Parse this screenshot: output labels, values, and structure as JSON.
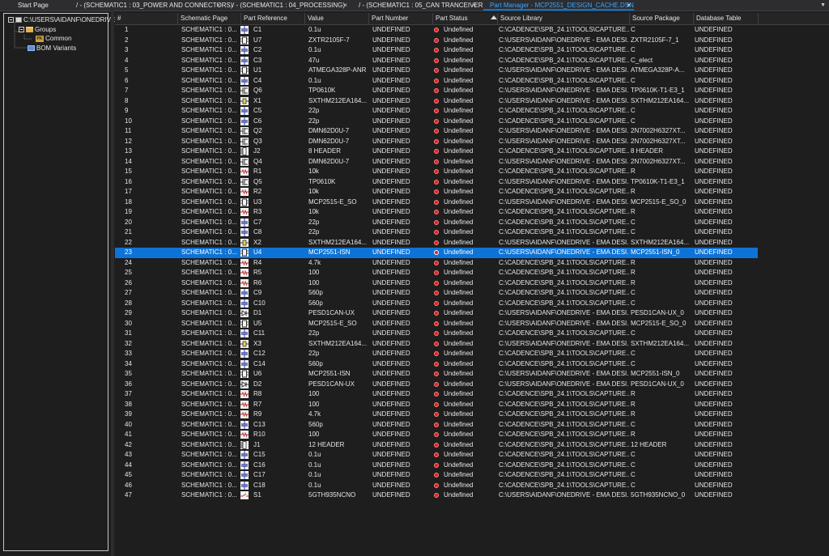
{
  "tabs": [
    {
      "label": "Start Page",
      "close": "×"
    },
    {
      "label": "/ - (SCHEMATIC1 : 03_POWER AND CONNECTORS)",
      "close": "×"
    },
    {
      "label": "/ - (SCHEMATIC1 : 04_PROCESSING)",
      "close": "×"
    },
    {
      "label": "/ - (SCHEMATIC1 : 05_CAN TRANCEIVERS)",
      "close": "×"
    },
    {
      "label": "Part Manager - MCP2551_DESIGN_CACHE.DSN",
      "close": "×",
      "active": true
    }
  ],
  "tab_dropdown": "▼",
  "tree": {
    "root": "C:\\USERS\\AIDANF\\ONEDRIVE",
    "groups": "Groups",
    "common": "Common",
    "common_badge": "PK",
    "bom": "BOM Variants"
  },
  "columns": [
    "#",
    "Schematic Page",
    "Part Reference",
    "Value",
    "Part Number",
    "Part Status",
    "Source Library",
    "Source Package",
    "Database Table"
  ],
  "selected_row": 22,
  "accent_color": "#0e73d6",
  "status_color": "#e51e1e",
  "rows": [
    {
      "n": "1",
      "page": "SCHEMATIC1 : 0...",
      "ref": "C1",
      "val": "0.1u",
      "pn": "UNDEFINED",
      "status": "Undefined",
      "lib": "C:\\CADENCE\\SPB_24.1\\TOOLS\\CAPTURE...",
      "pkg": "C",
      "db": "UNDEFINED",
      "icon": "cap"
    },
    {
      "n": "2",
      "page": "SCHEMATIC1 : 0...",
      "ref": "U7",
      "val": "ZXTR2105F-7",
      "pn": "UNDEFINED",
      "status": "Undefined",
      "lib": "C:\\USERS\\AIDANF\\ONEDRIVE - EMA DESI...",
      "pkg": "ZXTR2105F-7_1",
      "db": "UNDEFINED",
      "icon": "ic"
    },
    {
      "n": "3",
      "page": "SCHEMATIC1 : 0...",
      "ref": "C2",
      "val": "0.1u",
      "pn": "UNDEFINED",
      "status": "Undefined",
      "lib": "C:\\CADENCE\\SPB_24.1\\TOOLS\\CAPTURE...",
      "pkg": "C",
      "db": "UNDEFINED",
      "icon": "cap"
    },
    {
      "n": "4",
      "page": "SCHEMATIC1 : 0...",
      "ref": "C3",
      "val": "47u",
      "pn": "UNDEFINED",
      "status": "Undefined",
      "lib": "C:\\CADENCE\\SPB_24.1\\TOOLS\\CAPTURE...",
      "pkg": "C_elect",
      "db": "UNDEFINED",
      "icon": "cap"
    },
    {
      "n": "5",
      "page": "SCHEMATIC1 : 0...",
      "ref": "U1",
      "val": "ATMEGA328P-ANR",
      "pn": "UNDEFINED",
      "status": "Undefined",
      "lib": "C:\\USERS\\AIDANF\\ONEDRIVE - EMA DESI...",
      "pkg": "ATMEGA328P-A...",
      "db": "UNDEFINED",
      "icon": "ic"
    },
    {
      "n": "6",
      "page": "SCHEMATIC1 : 0...",
      "ref": "C4",
      "val": "0.1u",
      "pn": "UNDEFINED",
      "status": "Undefined",
      "lib": "C:\\CADENCE\\SPB_24.1\\TOOLS\\CAPTURE...",
      "pkg": "C",
      "db": "UNDEFINED",
      "icon": "cap"
    },
    {
      "n": "7",
      "page": "SCHEMATIC1 : 0...",
      "ref": "Q6",
      "val": "TP0610K",
      "pn": "UNDEFINED",
      "status": "Undefined",
      "lib": "C:\\USERS\\AIDANF\\ONEDRIVE - EMA DESI...",
      "pkg": "TP0610K-T1-E3_1",
      "db": "UNDEFINED",
      "icon": "fet"
    },
    {
      "n": "8",
      "page": "SCHEMATIC1 : 0...",
      "ref": "X1",
      "val": "SXTHM212EA164...",
      "pn": "UNDEFINED",
      "status": "Undefined",
      "lib": "C:\\USERS\\AIDANF\\ONEDRIVE - EMA DESI...",
      "pkg": "SXTHM212EA164...",
      "db": "UNDEFINED",
      "icon": "xtal"
    },
    {
      "n": "9",
      "page": "SCHEMATIC1 : 0...",
      "ref": "C5",
      "val": "22p",
      "pn": "UNDEFINED",
      "status": "Undefined",
      "lib": "C:\\CADENCE\\SPB_24.1\\TOOLS\\CAPTURE...",
      "pkg": "C",
      "db": "UNDEFINED",
      "icon": "cap"
    },
    {
      "n": "10",
      "page": "SCHEMATIC1 : 0...",
      "ref": "C6",
      "val": "22p",
      "pn": "UNDEFINED",
      "status": "Undefined",
      "lib": "C:\\CADENCE\\SPB_24.1\\TOOLS\\CAPTURE...",
      "pkg": "C",
      "db": "UNDEFINED",
      "icon": "cap"
    },
    {
      "n": "11",
      "page": "SCHEMATIC1 : 0...",
      "ref": "Q2",
      "val": "DMN62D0U-7",
      "pn": "UNDEFINED",
      "status": "Undefined",
      "lib": "C:\\USERS\\AIDANF\\ONEDRIVE - EMA DESI...",
      "pkg": "2N7002H6327XT...",
      "db": "UNDEFINED",
      "icon": "fet"
    },
    {
      "n": "12",
      "page": "SCHEMATIC1 : 0...",
      "ref": "Q3",
      "val": "DMN62D0U-7",
      "pn": "UNDEFINED",
      "status": "Undefined",
      "lib": "C:\\USERS\\AIDANF\\ONEDRIVE - EMA DESI...",
      "pkg": "2N7002H6327XT...",
      "db": "UNDEFINED",
      "icon": "fet"
    },
    {
      "n": "13",
      "page": "SCHEMATIC1 : 0...",
      "ref": "J2",
      "val": "8 HEADER",
      "pn": "UNDEFINED",
      "status": "Undefined",
      "lib": "C:\\CADENCE\\SPB_24.1\\TOOLS\\CAPTURE...",
      "pkg": "8 HEADER",
      "db": "UNDEFINED",
      "icon": "hdr"
    },
    {
      "n": "14",
      "page": "SCHEMATIC1 : 0...",
      "ref": "Q4",
      "val": "DMN62D0U-7",
      "pn": "UNDEFINED",
      "status": "Undefined",
      "lib": "C:\\USERS\\AIDANF\\ONEDRIVE - EMA DESI...",
      "pkg": "2N7002H6327XT...",
      "db": "UNDEFINED",
      "icon": "fet"
    },
    {
      "n": "15",
      "page": "SCHEMATIC1 : 0...",
      "ref": "R1",
      "val": "10k",
      "pn": "UNDEFINED",
      "status": "Undefined",
      "lib": "C:\\CADENCE\\SPB_24.1\\TOOLS\\CAPTURE...",
      "pkg": "R",
      "db": "UNDEFINED",
      "icon": "res"
    },
    {
      "n": "16",
      "page": "SCHEMATIC1 : 0...",
      "ref": "Q5",
      "val": "TP0610K",
      "pn": "UNDEFINED",
      "status": "Undefined",
      "lib": "C:\\USERS\\AIDANF\\ONEDRIVE - EMA DESI...",
      "pkg": "TP0610K-T1-E3_1",
      "db": "UNDEFINED",
      "icon": "fet"
    },
    {
      "n": "17",
      "page": "SCHEMATIC1 : 0...",
      "ref": "R2",
      "val": "10k",
      "pn": "UNDEFINED",
      "status": "Undefined",
      "lib": "C:\\CADENCE\\SPB_24.1\\TOOLS\\CAPTURE...",
      "pkg": "R",
      "db": "UNDEFINED",
      "icon": "res"
    },
    {
      "n": "18",
      "page": "SCHEMATIC1 : 0...",
      "ref": "U3",
      "val": "MCP2515-E_SO",
      "pn": "UNDEFINED",
      "status": "Undefined",
      "lib": "C:\\USERS\\AIDANF\\ONEDRIVE - EMA DESI...",
      "pkg": "MCP2515-E_SO_0",
      "db": "UNDEFINED",
      "icon": "ic"
    },
    {
      "n": "19",
      "page": "SCHEMATIC1 : 0...",
      "ref": "R3",
      "val": "10k",
      "pn": "UNDEFINED",
      "status": "Undefined",
      "lib": "C:\\CADENCE\\SPB_24.1\\TOOLS\\CAPTURE...",
      "pkg": "R",
      "db": "UNDEFINED",
      "icon": "res"
    },
    {
      "n": "20",
      "page": "SCHEMATIC1 : 0...",
      "ref": "C7",
      "val": "22p",
      "pn": "UNDEFINED",
      "status": "Undefined",
      "lib": "C:\\CADENCE\\SPB_24.1\\TOOLS\\CAPTURE...",
      "pkg": "C",
      "db": "UNDEFINED",
      "icon": "cap"
    },
    {
      "n": "21",
      "page": "SCHEMATIC1 : 0...",
      "ref": "C8",
      "val": "22p",
      "pn": "UNDEFINED",
      "status": "Undefined",
      "lib": "C:\\CADENCE\\SPB_24.1\\TOOLS\\CAPTURE...",
      "pkg": "C",
      "db": "UNDEFINED",
      "icon": "cap"
    },
    {
      "n": "22",
      "page": "SCHEMATIC1 : 0...",
      "ref": "X2",
      "val": "SXTHM212EA164...",
      "pn": "UNDEFINED",
      "status": "Undefined",
      "lib": "C:\\USERS\\AIDANF\\ONEDRIVE - EMA DESI...",
      "pkg": "SXTHM212EA164...",
      "db": "UNDEFINED",
      "icon": "xtal"
    },
    {
      "n": "23",
      "page": "SCHEMATIC1 : 0...",
      "ref": "U4",
      "val": "MCP2551-ISN",
      "pn": "UNDEFINED",
      "status": "Undefined",
      "lib": "C:\\USERS\\AIDANF\\ONEDRIVE - EMA DESI...",
      "pkg": "MCP2551-ISN_0",
      "db": "UNDEFINED",
      "icon": "ic"
    },
    {
      "n": "24",
      "page": "SCHEMATIC1 : 0...",
      "ref": "R4",
      "val": "4.7k",
      "pn": "UNDEFINED",
      "status": "Undefined",
      "lib": "C:\\CADENCE\\SPB_24.1\\TOOLS\\CAPTURE...",
      "pkg": "R",
      "db": "UNDEFINED",
      "icon": "res"
    },
    {
      "n": "25",
      "page": "SCHEMATIC1 : 0...",
      "ref": "R5",
      "val": "100",
      "pn": "UNDEFINED",
      "status": "Undefined",
      "lib": "C:\\CADENCE\\SPB_24.1\\TOOLS\\CAPTURE...",
      "pkg": "R",
      "db": "UNDEFINED",
      "icon": "res"
    },
    {
      "n": "26",
      "page": "SCHEMATIC1 : 0...",
      "ref": "R6",
      "val": "100",
      "pn": "UNDEFINED",
      "status": "Undefined",
      "lib": "C:\\CADENCE\\SPB_24.1\\TOOLS\\CAPTURE...",
      "pkg": "R",
      "db": "UNDEFINED",
      "icon": "res"
    },
    {
      "n": "27",
      "page": "SCHEMATIC1 : 0...",
      "ref": "C9",
      "val": "560p",
      "pn": "UNDEFINED",
      "status": "Undefined",
      "lib": "C:\\CADENCE\\SPB_24.1\\TOOLS\\CAPTURE...",
      "pkg": "C",
      "db": "UNDEFINED",
      "icon": "cap"
    },
    {
      "n": "28",
      "page": "SCHEMATIC1 : 0...",
      "ref": "C10",
      "val": "560p",
      "pn": "UNDEFINED",
      "status": "Undefined",
      "lib": "C:\\CADENCE\\SPB_24.1\\TOOLS\\CAPTURE...",
      "pkg": "C",
      "db": "UNDEFINED",
      "icon": "cap"
    },
    {
      "n": "29",
      "page": "SCHEMATIC1 : 0...",
      "ref": "D1",
      "val": "PESD1CAN-UX",
      "pn": "UNDEFINED",
      "status": "Undefined",
      "lib": "C:\\USERS\\AIDANF\\ONEDRIVE - EMA DESI...",
      "pkg": "PESD1CAN-UX_0",
      "db": "UNDEFINED",
      "icon": "diode"
    },
    {
      "n": "30",
      "page": "SCHEMATIC1 : 0...",
      "ref": "U5",
      "val": "MCP2515-E_SO",
      "pn": "UNDEFINED",
      "status": "Undefined",
      "lib": "C:\\USERS\\AIDANF\\ONEDRIVE - EMA DESI...",
      "pkg": "MCP2515-E_SO_0",
      "db": "UNDEFINED",
      "icon": "ic"
    },
    {
      "n": "31",
      "page": "SCHEMATIC1 : 0...",
      "ref": "C11",
      "val": "22p",
      "pn": "UNDEFINED",
      "status": "Undefined",
      "lib": "C:\\CADENCE\\SPB_24.1\\TOOLS\\CAPTURE...",
      "pkg": "C",
      "db": "UNDEFINED",
      "icon": "cap"
    },
    {
      "n": "32",
      "page": "SCHEMATIC1 : 0...",
      "ref": "X3",
      "val": "SXTHM212EA164...",
      "pn": "UNDEFINED",
      "status": "Undefined",
      "lib": "C:\\USERS\\AIDANF\\ONEDRIVE - EMA DESI...",
      "pkg": "SXTHM212EA164...",
      "db": "UNDEFINED",
      "icon": "xtal"
    },
    {
      "n": "33",
      "page": "SCHEMATIC1 : 0...",
      "ref": "C12",
      "val": "22p",
      "pn": "UNDEFINED",
      "status": "Undefined",
      "lib": "C:\\CADENCE\\SPB_24.1\\TOOLS\\CAPTURE...",
      "pkg": "C",
      "db": "UNDEFINED",
      "icon": "cap"
    },
    {
      "n": "34",
      "page": "SCHEMATIC1 : 0...",
      "ref": "C14",
      "val": "560p",
      "pn": "UNDEFINED",
      "status": "Undefined",
      "lib": "C:\\CADENCE\\SPB_24.1\\TOOLS\\CAPTURE...",
      "pkg": "C",
      "db": "UNDEFINED",
      "icon": "cap"
    },
    {
      "n": "35",
      "page": "SCHEMATIC1 : 0...",
      "ref": "U6",
      "val": "MCP2551-ISN",
      "pn": "UNDEFINED",
      "status": "Undefined",
      "lib": "C:\\USERS\\AIDANF\\ONEDRIVE - EMA DESI...",
      "pkg": "MCP2551-ISN_0",
      "db": "UNDEFINED",
      "icon": "ic"
    },
    {
      "n": "36",
      "page": "SCHEMATIC1 : 0...",
      "ref": "D2",
      "val": "PESD1CAN-UX",
      "pn": "UNDEFINED",
      "status": "Undefined",
      "lib": "C:\\USERS\\AIDANF\\ONEDRIVE - EMA DESI...",
      "pkg": "PESD1CAN-UX_0",
      "db": "UNDEFINED",
      "icon": "diode"
    },
    {
      "n": "37",
      "page": "SCHEMATIC1 : 0...",
      "ref": "R8",
      "val": "100",
      "pn": "UNDEFINED",
      "status": "Undefined",
      "lib": "C:\\CADENCE\\SPB_24.1\\TOOLS\\CAPTURE...",
      "pkg": "R",
      "db": "UNDEFINED",
      "icon": "res"
    },
    {
      "n": "38",
      "page": "SCHEMATIC1 : 0...",
      "ref": "R7",
      "val": "100",
      "pn": "UNDEFINED",
      "status": "Undefined",
      "lib": "C:\\CADENCE\\SPB_24.1\\TOOLS\\CAPTURE...",
      "pkg": "R",
      "db": "UNDEFINED",
      "icon": "res"
    },
    {
      "n": "39",
      "page": "SCHEMATIC1 : 0...",
      "ref": "R9",
      "val": "4.7k",
      "pn": "UNDEFINED",
      "status": "Undefined",
      "lib": "C:\\CADENCE\\SPB_24.1\\TOOLS\\CAPTURE...",
      "pkg": "R",
      "db": "UNDEFINED",
      "icon": "res"
    },
    {
      "n": "40",
      "page": "SCHEMATIC1 : 0...",
      "ref": "C13",
      "val": "560p",
      "pn": "UNDEFINED",
      "status": "Undefined",
      "lib": "C:\\CADENCE\\SPB_24.1\\TOOLS\\CAPTURE...",
      "pkg": "C",
      "db": "UNDEFINED",
      "icon": "cap"
    },
    {
      "n": "41",
      "page": "SCHEMATIC1 : 0...",
      "ref": "R10",
      "val": "100",
      "pn": "UNDEFINED",
      "status": "Undefined",
      "lib": "C:\\CADENCE\\SPB_24.1\\TOOLS\\CAPTURE...",
      "pkg": "R",
      "db": "UNDEFINED",
      "icon": "res"
    },
    {
      "n": "42",
      "page": "SCHEMATIC1 : 0...",
      "ref": "J1",
      "val": "12 HEADER",
      "pn": "UNDEFINED",
      "status": "Undefined",
      "lib": "C:\\CADENCE\\SPB_24.1\\TOOLS\\CAPTURE...",
      "pkg": "12 HEADER",
      "db": "UNDEFINED",
      "icon": "hdr"
    },
    {
      "n": "43",
      "page": "SCHEMATIC1 : 0...",
      "ref": "C15",
      "val": "0.1u",
      "pn": "UNDEFINED",
      "status": "Undefined",
      "lib": "C:\\CADENCE\\SPB_24.1\\TOOLS\\CAPTURE...",
      "pkg": "C",
      "db": "UNDEFINED",
      "icon": "cap"
    },
    {
      "n": "44",
      "page": "SCHEMATIC1 : 0...",
      "ref": "C16",
      "val": "0.1u",
      "pn": "UNDEFINED",
      "status": "Undefined",
      "lib": "C:\\CADENCE\\SPB_24.1\\TOOLS\\CAPTURE...",
      "pkg": "C",
      "db": "UNDEFINED",
      "icon": "cap"
    },
    {
      "n": "45",
      "page": "SCHEMATIC1 : 0...",
      "ref": "C17",
      "val": "0.1u",
      "pn": "UNDEFINED",
      "status": "Undefined",
      "lib": "C:\\CADENCE\\SPB_24.1\\TOOLS\\CAPTURE...",
      "pkg": "C",
      "db": "UNDEFINED",
      "icon": "cap"
    },
    {
      "n": "46",
      "page": "SCHEMATIC1 : 0...",
      "ref": "C18",
      "val": "0.1u",
      "pn": "UNDEFINED",
      "status": "Undefined",
      "lib": "C:\\CADENCE\\SPB_24.1\\TOOLS\\CAPTURE...",
      "pkg": "C",
      "db": "UNDEFINED",
      "icon": "cap"
    },
    {
      "n": "47",
      "page": "SCHEMATIC1 : 0...",
      "ref": "S1",
      "val": "5GTH935NCNO",
      "pn": "UNDEFINED",
      "status": "Undefined",
      "lib": "C:\\USERS\\AIDANF\\ONEDRIVE - EMA DESI...",
      "pkg": "5GTH935NCNO_0",
      "db": "UNDEFINED",
      "icon": "switch"
    }
  ]
}
